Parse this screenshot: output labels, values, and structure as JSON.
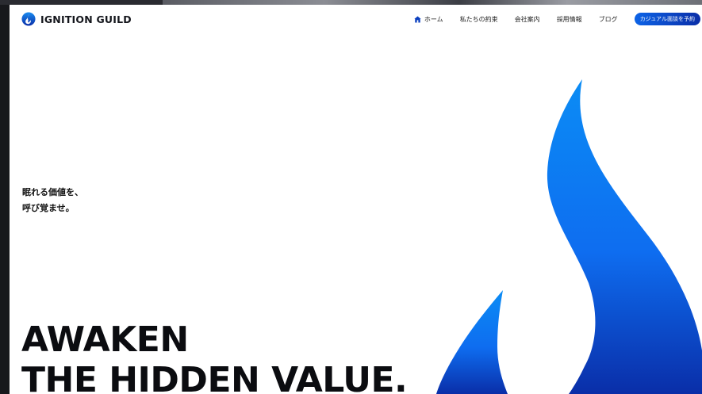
{
  "brand": {
    "name": "IGNITION GUILD"
  },
  "nav": {
    "items": [
      {
        "label": "ホーム",
        "icon": "home-icon"
      },
      {
        "label": "私たちの約束"
      },
      {
        "label": "会社案内"
      },
      {
        "label": "採用情報"
      },
      {
        "label": "ブログ"
      }
    ],
    "cta_label": "カジュアル面談を予約"
  },
  "hero": {
    "tagline_line1": "眠れる価値を、",
    "tagline_line2": "呼び覚ませ。",
    "title_line1": "AWAKEN",
    "title_line2": "THE HIDDEN VALUE."
  },
  "colors": {
    "accent_top": "#0b8cf5",
    "accent_bottom": "#0a2ea8",
    "text": "#111111",
    "background": "#ffffff"
  }
}
